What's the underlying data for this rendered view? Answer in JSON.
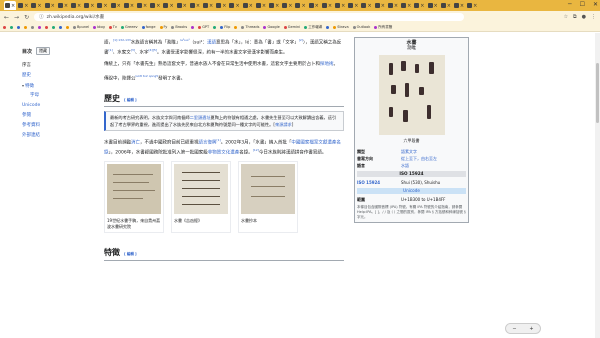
{
  "browser": {
    "tabs": [
      "",
      "",
      "",
      "",
      "",
      "",
      "",
      "",
      "",
      "",
      "",
      "",
      "",
      "",
      "",
      "",
      "",
      "",
      "",
      "",
      "",
      "",
      "",
      "",
      "",
      "",
      "",
      "",
      "",
      "",
      "",
      "",
      "",
      "",
      "",
      ""
    ],
    "active_tab_index": 0,
    "url": "zh.wikipedia.org/wiki/水書",
    "bookmarks": [
      "",
      "",
      "",
      "",
      "",
      "",
      "",
      "",
      "",
      "",
      "Bpunel",
      "blog",
      "Tv",
      "Greeev",
      "fonge",
      "Fy",
      "Brooks",
      "",
      "GPT",
      "",
      "Flip",
      "",
      "Threads",
      "Google",
      "Gemini",
      "工作報導",
      "",
      "Strava",
      "Outlook",
      "所有書籤"
    ]
  },
  "toc": {
    "title": "目次",
    "hide_label": "隱藏",
    "items": [
      {
        "label": "序言",
        "sub": false,
        "caret": false
      },
      {
        "label": "歷史",
        "sub": false,
        "caret": false
      },
      {
        "label": "特徵",
        "sub": false,
        "caret": true
      },
      {
        "label": "字母",
        "sub": true,
        "caret": false
      },
      {
        "label": "Unicode",
        "sub": false,
        "caret": false
      },
      {
        "label": "參閱",
        "sub": false,
        "caret": false
      },
      {
        "label": "參考資料",
        "sub": false,
        "caret": false
      },
      {
        "label": "外部連結",
        "sub": false,
        "caret": false
      }
    ]
  },
  "article": {
    "para1_a": "語，",
    "para1_sup1": "[1]:132-133",
    "para1_b": "水族語言稱其為「泐睢」",
    "para1_sup2": "le²sui¹",
    "para1_c": "（sui¹：",
    "para1_link1": "漢語",
    "para1_d": "意思為「水」，",
    "para1_e": "lé：意為「書」或「文字」",
    "para1_sup3": "[2]",
    "para1_f": "），漢語又稱之為反書",
    "para1_sup4": "[1]",
    "para1_g": "、水家文",
    "para1_sup5": "[3]",
    "para1_h": "、水字",
    "para1_sup6": "[4][5]",
    "para1_i": "。水書受漢字影響很深，約有一半的水書文字受漢字影響而產生。",
    "para2": "傳統上，只有「水書先生」熟悉這套文字，普通水族人不會在日常生活中使用水書，這套文字主要用於占卜和",
    "para2_link": "探地術",
    "para2_end": "。",
    "para3_a": "傳說中，陸鐸公",
    "para3_sup": "luk8 to2 qong5",
    "para3_b": "發明了水書。",
    "history_heading": "歷史",
    "edit_label": "[ 編輯 ]",
    "notice_a": "最新的考古研究表明，水族文字與河南偃師",
    "notice_link1": "二里頭遺址",
    "notice_b": "夏陶上的符號有相通之處，水書先生甚至可以大致解讀出含義，這引起了考古學界的重視，進而提出了水族先民來自北方和夏陶符號是同一種文字的可能性。[",
    "notice_link2": "來源請求",
    "notice_c": "]",
    "para4_a": "水書目前瀕臨",
    "para4_link1": "消亡",
    "para4_b": "，不過中國政府目前已經重視",
    "para4_link2": "語言復興",
    "para4_sup1": "[1]",
    "para4_c": "。2002年3月，「水書」納入首批「",
    "para4_link3": "中國國家檔案文獻遺產名錄",
    "para4_d": "」，2006年，水書經國務院批准列入第一批國家級",
    "para4_link4": "非物質文化遺產",
    "para4_e": "名錄。",
    "para4_sup2": "[12]",
    "para4_f": "今日水族則將漢語拼音作書寫語。",
    "gallery": [
      {
        "caption": "19世紀水書手稿，來自貴州荔波水書研究院"
      },
      {
        "caption": "水書《吉凶經》"
      },
      {
        "caption": "水書抄本"
      }
    ],
    "features_heading": "特徵"
  },
  "infobox": {
    "title": "水書",
    "subtitle": "泐睢",
    "caption": "六甲段書",
    "rows": [
      {
        "key": "類型",
        "value": "語素文字"
      },
      {
        "key": "書寫方向",
        "value": "從上至下，由右至左"
      },
      {
        "key": "語言",
        "value": "水語"
      }
    ],
    "iso_band": "ISO 15924",
    "iso_row": {
      "key": "ISO 15924",
      "value": "Shui (530), Shuishu"
    },
    "unicode_band": "Unicode",
    "unicode_row": {
      "key": "範圍",
      "value": "U+1B300 to U+1B4FF"
    },
    "footnote": "本條目包含國際音標 (IPA) 符號。有關 IPA 符號的介紹指南，請參閱 Help:IPA。[ ]、/ / 及 ⟨ ⟩ 之間的區別，參閱 IPA § 方括號和斜線括號 § 字元。"
  },
  "zoom": {
    "minus": "−",
    "plus": "+"
  }
}
